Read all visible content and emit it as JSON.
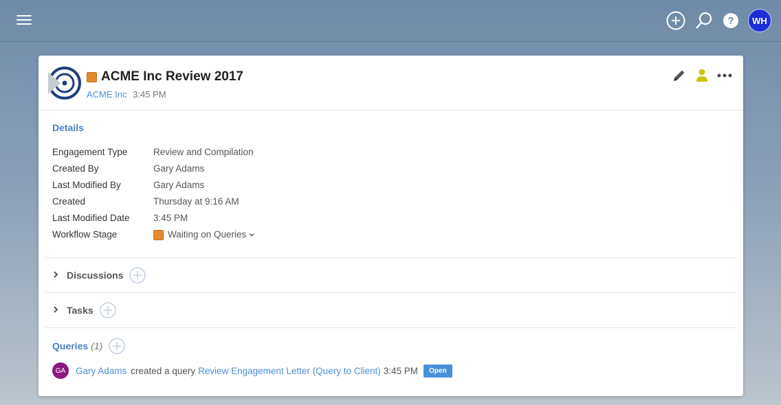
{
  "colors": {
    "accent": "#4a90d9",
    "stage": "#e38a2e",
    "avatar_wh": "#1c2fd6",
    "avatar_ga": "#8b1a7d"
  },
  "topbar": {
    "menu_icon": "hamburger-icon",
    "icons": [
      "add-circle-icon",
      "search-icon",
      "help-icon"
    ],
    "user_initials": "WH"
  },
  "engagement": {
    "title": "ACME Inc Review 2017",
    "client": "ACME Inc",
    "time": "3:45 PM",
    "actions": [
      "pencil-icon",
      "person-icon",
      "more-icon"
    ]
  },
  "details": {
    "heading": "Details",
    "rows": [
      {
        "label": "Engagement Type",
        "value": "Review and Compilation"
      },
      {
        "label": "Created By",
        "value": "Gary Adams"
      },
      {
        "label": "Last Modified By",
        "value": "Gary Adams"
      },
      {
        "label": "Created",
        "value": "Thursday at 9:16 AM"
      },
      {
        "label": "Last Modified Date",
        "value": "3:45 PM"
      },
      {
        "label": "Workflow Stage",
        "value": "Waiting on Queries"
      }
    ]
  },
  "sections": {
    "discussions": "Discussions",
    "tasks": "Tasks",
    "queries": "Queries",
    "queries_count": "(1)"
  },
  "activity": {
    "initials": "GA",
    "user": "Gary Adams",
    "action": "created a query",
    "item": "Review Engagement Letter (Query to Client)",
    "time": "3:45 PM",
    "status": "Open"
  }
}
